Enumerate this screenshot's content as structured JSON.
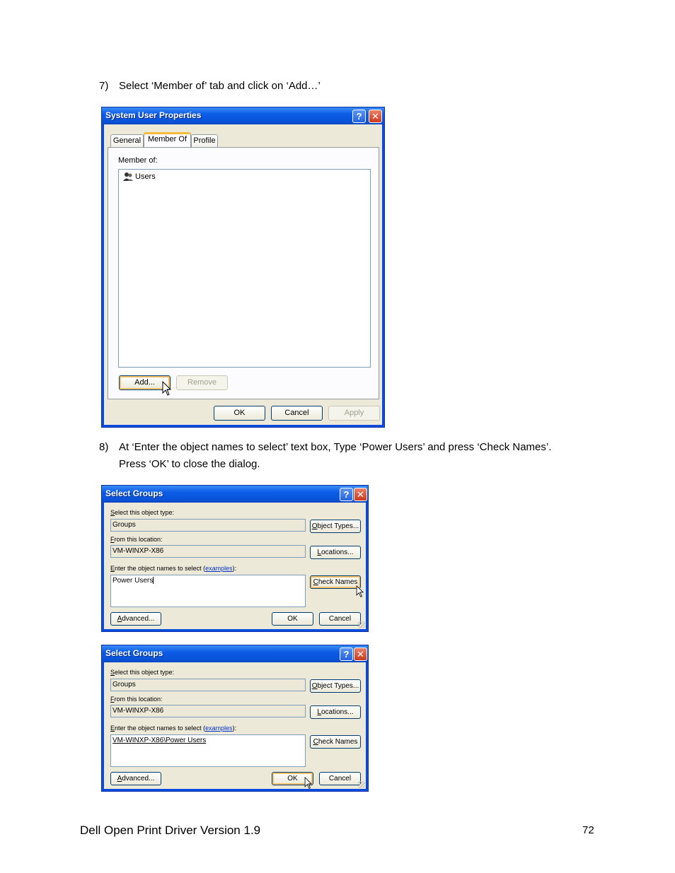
{
  "steps": [
    {
      "number": "7)",
      "line1": "Select ‘Member of’ tab and click on ‘Add…’"
    },
    {
      "number": "8)",
      "line1": "At ‘Enter the object names to select’ text box, Type ‘Power Users’ and press ‘Check Names’.",
      "line2": "Press ‘OK’ to close the dialog."
    }
  ],
  "properties_dialog": {
    "title": "System User Properties",
    "help_glyph": "?",
    "close_glyph": "✕",
    "tabs": [
      "General",
      "Member Of",
      "Profile"
    ],
    "active_tab": "Member Of",
    "member_of_label": "Member of:",
    "members": [
      {
        "name": "Users",
        "icon": "group-icon"
      }
    ],
    "add_button": "Add...",
    "remove_button": "Remove",
    "ok_button": "OK",
    "cancel_button": "Cancel",
    "apply_button": "Apply"
  },
  "select_groups_1": {
    "title": "Select Groups",
    "object_type_label_hot": "S",
    "object_type_label_rest": "elect this object type:",
    "object_type_value": "Groups",
    "object_types_button_hot": "O",
    "object_types_button_rest": "bject Types...",
    "location_label_hot": "F",
    "location_label_rest": "rom this location:",
    "location_value": "VM-WINXP-X86",
    "locations_button_hot": "L",
    "locations_button_rest": "ocations...",
    "names_label_hot": "E",
    "names_label_rest": "nter the object names to select (",
    "examples_link": "examples",
    "names_label_end": "):",
    "names_value": "Power Users",
    "check_names_button_hot": "C",
    "check_names_button_rest": "heck Names",
    "advanced_button_hot": "A",
    "advanced_button_rest": "dvanced...",
    "ok_button": "OK",
    "cancel_button": "Cancel"
  },
  "select_groups_2": {
    "title": "Select Groups",
    "object_type_label_hot": "S",
    "object_type_label_rest": "elect this object type:",
    "object_type_value": "Groups",
    "object_types_button_hot": "O",
    "object_types_button_rest": "bject Types...",
    "location_label_hot": "F",
    "location_label_rest": "rom this location:",
    "location_value": "VM-WINXP-X86",
    "locations_button_hot": "L",
    "locations_button_rest": "ocations...",
    "names_label_hot": "E",
    "names_label_rest": "nter the object names to select (",
    "examples_link": "examples",
    "names_label_end": "):",
    "names_value": "VM-WINXP-X86\\Power Users",
    "check_names_button_hot": "C",
    "check_names_button_rest": "heck Names",
    "advanced_button_hot": "A",
    "advanced_button_rest": "dvanced...",
    "ok_button": "OK",
    "cancel_button": "Cancel"
  },
  "footer": {
    "title": "Dell Open Print Driver Version 1.9",
    "page_number": "72"
  }
}
